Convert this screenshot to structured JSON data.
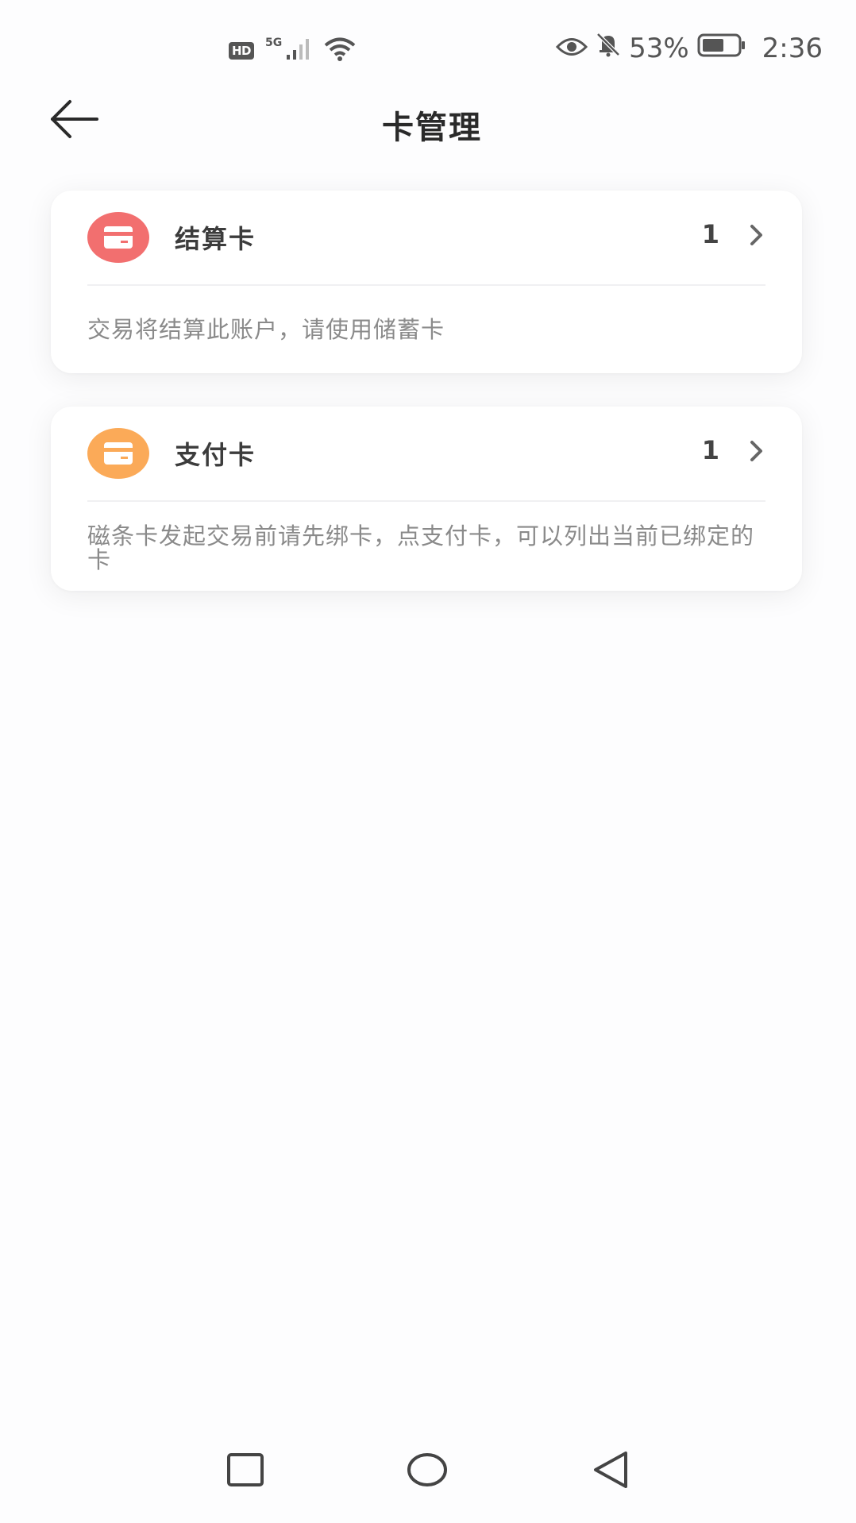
{
  "status_bar": {
    "hd_badge": "HD",
    "network_type": "5G",
    "battery_percent": "53%",
    "time": "2:36",
    "icons": [
      "hd-icon",
      "signal-icon",
      "wifi-icon",
      "eye-icon",
      "bell-off-icon",
      "battery-icon"
    ]
  },
  "header": {
    "title": "卡管理",
    "back_icon": "arrow-left-icon"
  },
  "cards": [
    {
      "label": "结算卡",
      "count": "1",
      "description": "交易将结算此账户，请使用储蓄卡",
      "icon": "credit-card-icon",
      "icon_color": "#f26f6f"
    },
    {
      "label": "支付卡",
      "count": "1",
      "description": "磁条卡发起交易前请先绑卡，点支付卡，可以列出当前已绑定的卡",
      "icon": "credit-card-icon",
      "icon_color": "#fbaa58"
    }
  ],
  "nav_bar": {
    "buttons": [
      "recent-apps-icon",
      "home-icon",
      "back-icon"
    ]
  }
}
